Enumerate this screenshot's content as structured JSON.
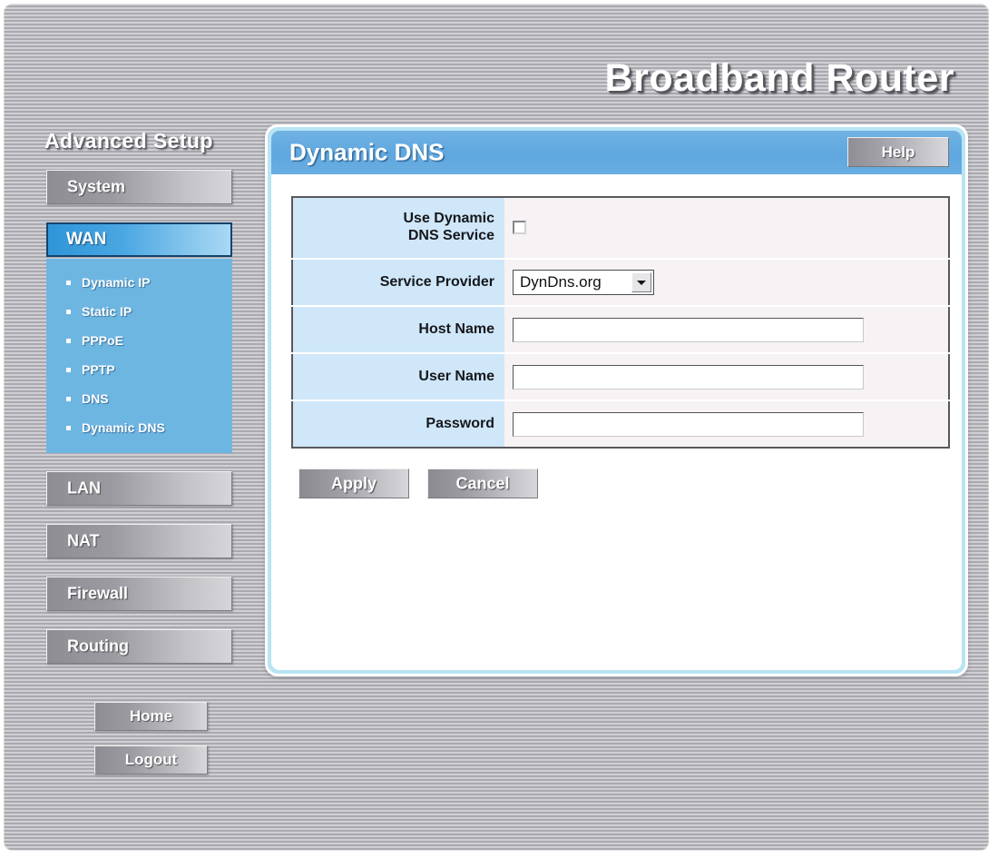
{
  "window": {
    "brand_title": "Broadband Router"
  },
  "sidebar": {
    "heading": "Advanced Setup",
    "items": [
      {
        "label": "System",
        "active": false
      },
      {
        "label": "WAN",
        "active": true
      },
      {
        "label": "LAN",
        "active": false
      },
      {
        "label": "NAT",
        "active": false
      },
      {
        "label": "Firewall",
        "active": false
      },
      {
        "label": "Routing",
        "active": false
      }
    ],
    "wan_submenu": [
      {
        "label": "Dynamic IP"
      },
      {
        "label": "Static IP"
      },
      {
        "label": "PPPoE"
      },
      {
        "label": "PPTP"
      },
      {
        "label": "DNS"
      },
      {
        "label": "Dynamic DNS"
      }
    ],
    "bottom_buttons": [
      {
        "label": "Home"
      },
      {
        "label": "Logout"
      }
    ]
  },
  "panel": {
    "title": "Dynamic DNS",
    "help_label": "Help",
    "form": {
      "use_ddns": {
        "label_line1": "Use Dynamic",
        "label_line2": "DNS Service",
        "checked": false
      },
      "service_provider": {
        "label": "Service Provider",
        "selected": "DynDns.org"
      },
      "host_name": {
        "label": "Host Name",
        "value": "",
        "placeholder": ""
      },
      "user_name": {
        "label": "User Name",
        "value": "",
        "placeholder": ""
      },
      "password": {
        "label": "Password",
        "value": "",
        "placeholder": ""
      }
    },
    "actions": {
      "apply_label": "Apply",
      "cancel_label": "Cancel"
    }
  },
  "colors": {
    "accent_blue": "#5ea7df",
    "submenu_blue": "#6eb6e2",
    "panel_border": "#b9e4f3",
    "label_cell": "#cfe7f8",
    "value_cell": "#f7f2f4",
    "chrome_gray": "#a9a9af"
  }
}
